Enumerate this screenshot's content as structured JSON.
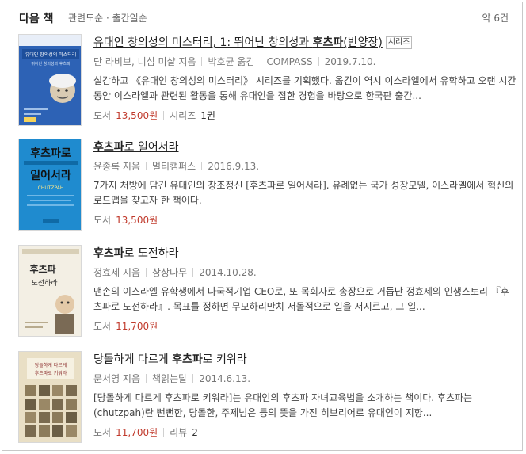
{
  "header": {
    "title": "다음 책",
    "subtitle": "관련도순 · 출간일순",
    "count": "약 6건"
  },
  "books": [
    {
      "title_pre": "유대인 창의성의 미스터리, 1: 뛰어난 창의성과 ",
      "title_hl": "후츠파",
      "title_post": "(반양장)",
      "tag": "시리즈",
      "author": "단 라비브, 니심 미샬 지음",
      "translator": "박호균 옮김",
      "publisher": "COMPASS",
      "date": "2019.7.10.",
      "desc": "실감하고 《유대인 창의성의 미스터리》 시리즈를 기획했다. 옮긴이 역시 이스라엘에서 유학하고 오랜 시간 동안 이스라엘과 관련된 활동을 통해 유대인을 접한 경험을 바탕으로 한국판 출간...",
      "type": "도서",
      "price": "13,500원",
      "extra_label": "시리즈",
      "extra_value": "1권",
      "cover": {
        "bg": "#2d62b5",
        "title": "유대인 창의성의 미스터리",
        "sub": "뛰어난 창의성과 후츠파"
      }
    },
    {
      "title_pre": "",
      "title_hl": "후츠파",
      "title_post": "로 일어서라",
      "author": "윤종록 지음",
      "publisher": "멀티캠퍼스",
      "date": "2016.9.13.",
      "desc": "7가지 처방에 담긴 유대인의 창조정신 [후츠파로 일어서라]. 유례없는 국가 성장모델, 이스라엘에서 혁신의 로드맵을 찾고자 한 책이다.",
      "type": "도서",
      "price": "13,500원",
      "cover": {
        "bg": "#1f8bcf",
        "title1": "후츠파로",
        "title2": "일어서라",
        "en": "CHUTZPAH"
      }
    },
    {
      "title_pre": "",
      "title_hl": "후츠파",
      "title_post": "로 도전하라",
      "author": "정효제 지음",
      "publisher": "상상나무",
      "date": "2014.10.28.",
      "desc": "맨손의 이스라엘 유학생에서 다국적기업 CEO로, 또 목회자로 총장으로 거듭난 정효제의 인생스토리 『후츠파로 도전하라』. 목표를 정하면 무모하리만치 저돌적으로 일을 저지르고, 그 일...",
      "type": "도서",
      "price": "11,700원",
      "cover": {
        "bg": "#f3efe4",
        "title1": "후츠파",
        "title2": "도전하라"
      }
    },
    {
      "title_pre": "당돌하게 다르게 ",
      "title_hl": "후츠파",
      "title_post": "로 키워라",
      "author": "문서영 지음",
      "publisher": "책읽는달",
      "date": "2014.6.13.",
      "desc": "[당돌하게 다르게 후츠파로 키워라]는 유대인의 후츠파 자녀교육법을 소개하는 책이다. 후츠파는 (chutzpah)란 뻔뻔한, 당돌한, 주제넘은 등의 뜻을 가진 히브리어로 유대인이 지향...",
      "type": "도서",
      "price": "11,700원",
      "extra_label": "리뷰",
      "extra_value": "2",
      "cover": {
        "bg": "#e9dfc5",
        "title1": "당돌하게 다르게",
        "title2": "후츠파로 키워라"
      }
    }
  ]
}
